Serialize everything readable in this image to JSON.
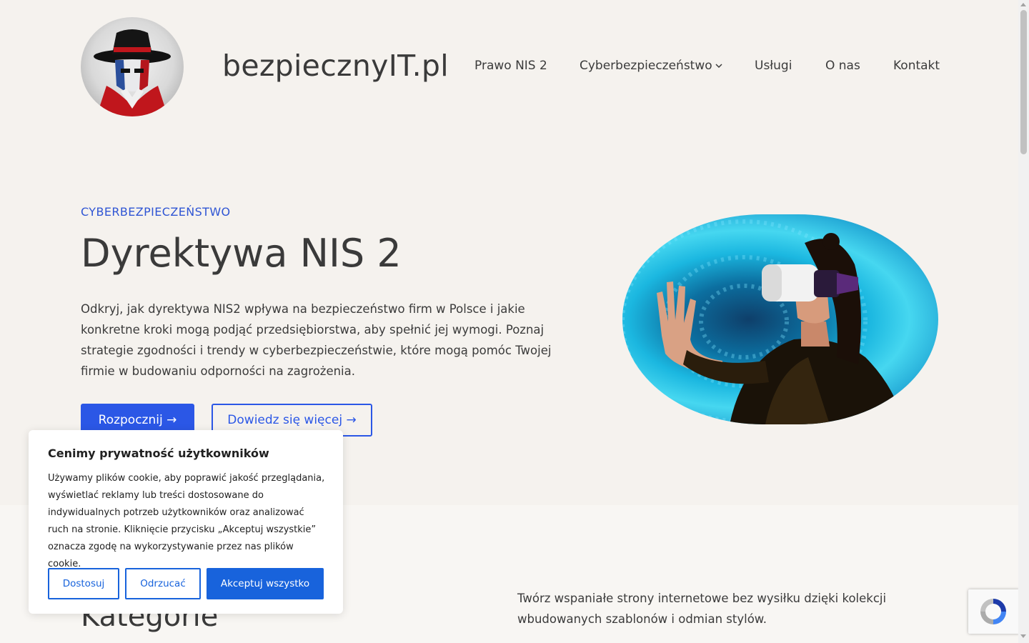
{
  "header": {
    "site_title": "bezpiecznyIT.pl",
    "logo_icon": "hacker-mascot-icon",
    "nav": [
      {
        "label": "Prawo NIS 2"
      },
      {
        "label": "Cyberbezpieczeństwo",
        "has_dropdown": true
      },
      {
        "label": "Usługi"
      },
      {
        "label": "O nas"
      },
      {
        "label": "Kontakt"
      }
    ]
  },
  "hero": {
    "eyebrow": "CYBERBEZPIECZEŃSTWO",
    "title": "Dyrektywa NIS 2",
    "description": "Odkryj, jak dyrektywa NIS2 wpływa na bezpieczeństwo firm w Polsce i jakie konkretne kroki mogą podjąć przedsiębiorstwa, aby spełnić jej wymogi. Poznaj strategie zgodności i trendy w cyberbezpieczeństwie, które mogą pomóc Twojej firmie w budowaniu odporności na zagrożenia.",
    "primary_button": "Rozpocznij →",
    "secondary_button": "Dowiedz się więcej →",
    "image_alt": "vr-headset-woman-image"
  },
  "lower": {
    "heading": "Kategorie",
    "text": "Twórz wspaniałe strony internetowe bez wysiłku dzięki kolekcji wbudowanych szablonów i odmian stylów."
  },
  "cookie_banner": {
    "title": "Cenimy prywatność użytkowników",
    "text": "Używamy plików cookie, aby poprawić jakość przeglądania, wyświetlać reklamy lub treści dostosowane do indywidualnych potrzeb użytkowników oraz analizować ruch na stronie. Kliknięcie przycisku „Akceptuj wszystkie” oznacza zgodę na wykorzystywanie przez nas plików cookie.",
    "customize": "Dostosuj",
    "reject": "Odrzucać",
    "accept_all": "Akceptuj wszystko"
  },
  "colors": {
    "accent": "#2b57e6",
    "cookie_accent": "#1863dc",
    "background": "#f5f2ee"
  }
}
